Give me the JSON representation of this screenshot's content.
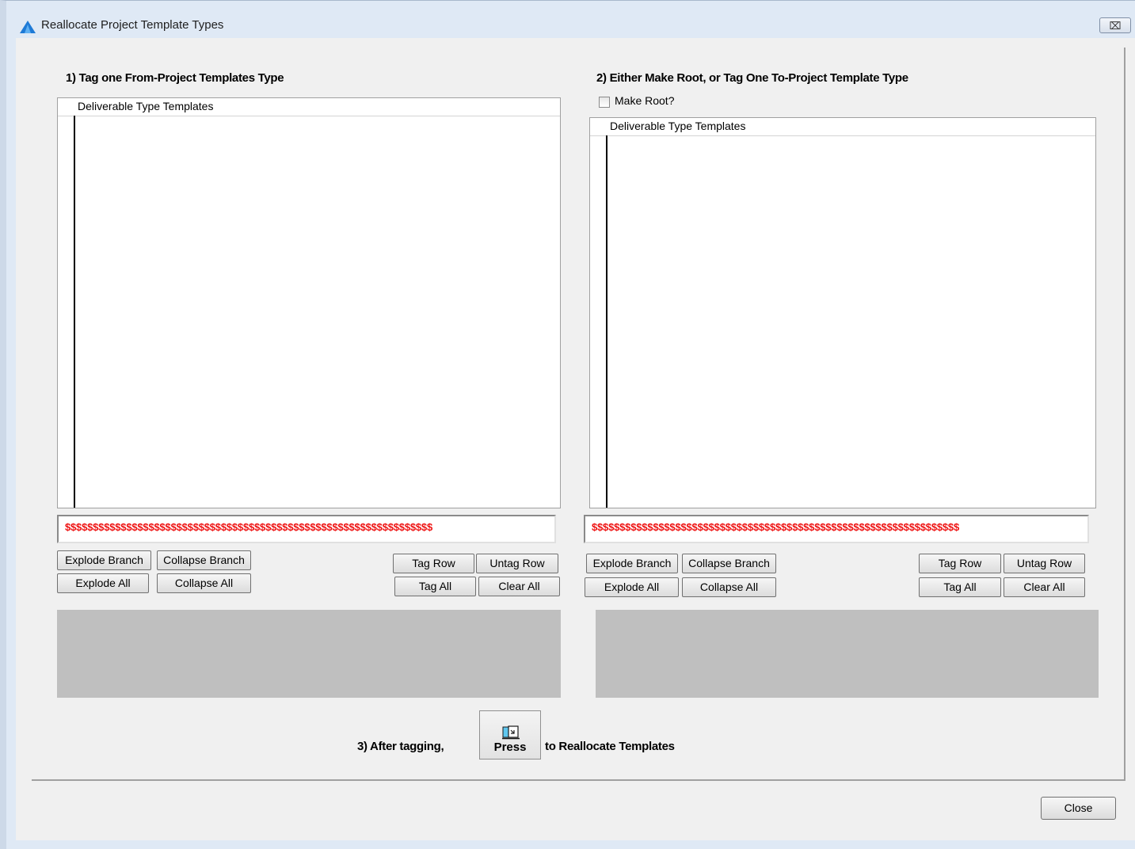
{
  "window": {
    "title": "Reallocate Project Template Types",
    "close_glyph": "⌧"
  },
  "left": {
    "heading": "1)  Tag one From-Project  Templates Type",
    "tree_header": "Deliverable Type Templates",
    "status": "$$$$$$$$$$$$$$$$$$$$$$$$$$$$$$$$$$$$$$$$$$$$$$$$$$$$$$$$$$$$$$$$$$",
    "buttons": {
      "explode_branch": "Explode Branch",
      "collapse_branch": "Collapse Branch",
      "explode_all": "Explode All",
      "collapse_all": "Collapse All",
      "tag_row": "Tag Row",
      "untag_row": "Untag Row",
      "tag_all": "Tag All",
      "clear_all": "Clear All"
    }
  },
  "right": {
    "heading": "2)  Either Make Root, or Tag One To-Project  Template Type",
    "make_root_label": "Make Root?",
    "make_root_checked": false,
    "tree_header": "Deliverable Type Templates",
    "status": "$$$$$$$$$$$$$$$$$$$$$$$$$$$$$$$$$$$$$$$$$$$$$$$$$$$$$$$$$$$$$$$$$$",
    "buttons": {
      "explode_branch": "Explode Branch",
      "collapse_branch": "Collapse Branch",
      "explode_all": "Explode All",
      "collapse_all": "Collapse All",
      "tag_row": "Tag Row",
      "untag_row": "Untag Row",
      "tag_all": "Tag All",
      "clear_all": "Clear All"
    }
  },
  "footer": {
    "step3_label": "3)  After tagging,",
    "press_label": "Press",
    "reallocate_label": "to Reallocate Templates",
    "close_label": "Close"
  },
  "colors": {
    "status_text": "#ee1111",
    "info_panel": "#bfbfbf",
    "window_frame": "#dfe9f5"
  }
}
